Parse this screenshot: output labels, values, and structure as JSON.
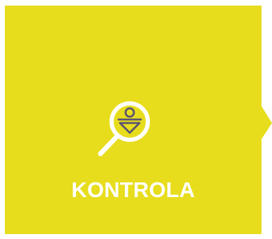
{
  "tile": {
    "label": "KONTROLA",
    "icon": "magnifier-person-icon"
  },
  "colors": {
    "tile_fill": "#e7dd1d",
    "label": "#ffffff",
    "icon_lens_ring": "#ffffff",
    "icon_figure": "#5b5470"
  }
}
